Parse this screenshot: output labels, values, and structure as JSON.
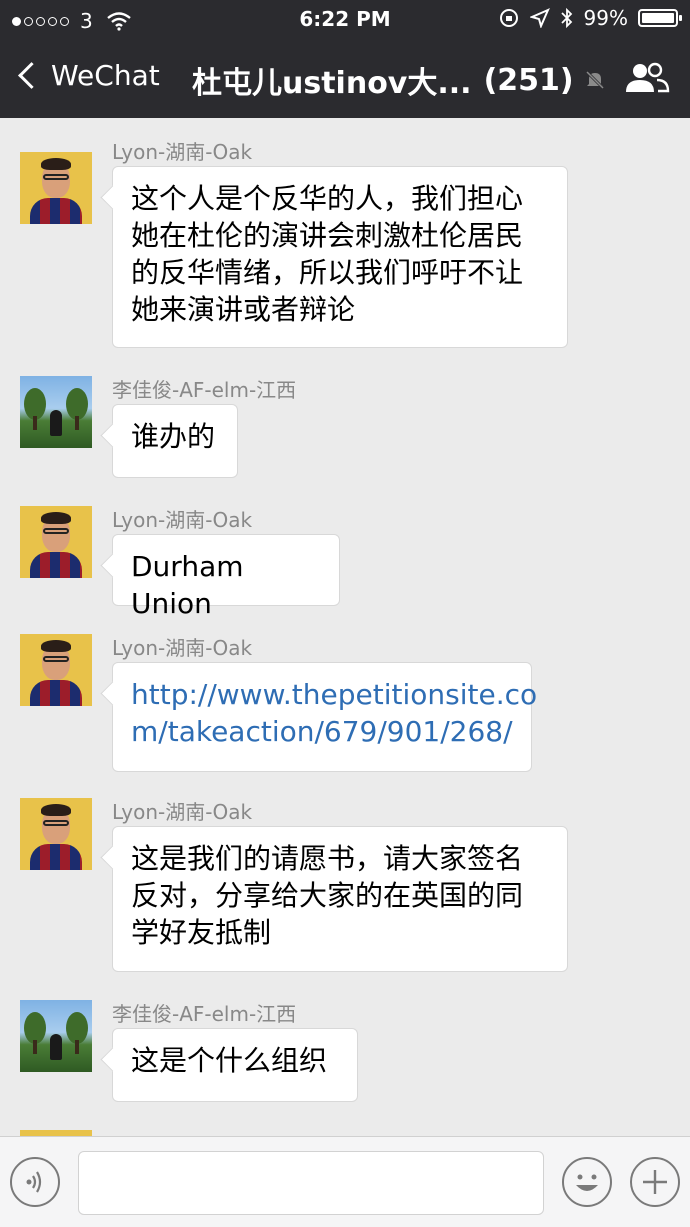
{
  "status_bar": {
    "carrier": "3",
    "time": "6:22 PM",
    "battery": "99%",
    "battery_level": 0.99,
    "signal_bars": 1
  },
  "nav": {
    "back_label": "WeChat",
    "title": "杜屯儿ustinov大...",
    "member_count": "(251)"
  },
  "messages": [
    {
      "sender": "Lyon-湖南-Oak",
      "text": "这个人是个反华的人，我们担心\n她在杜伦的演讲会刺激杜伦居民\n的反华情绪，所以我们呼吁不让\n她来演讲或者辩论",
      "avatar": "lyon-avatar"
    },
    {
      "sender": "李佳俊-AF-elm-江西",
      "text": "谁办的",
      "avatar": "li-avatar"
    },
    {
      "sender": "Lyon-湖南-Oak",
      "text": "Durham Union",
      "avatar": "lyon-avatar"
    },
    {
      "sender": "Lyon-湖南-Oak",
      "text": "http://www.thepetitionsite.co\nm/takeaction/679/901/268/",
      "avatar": "lyon-avatar",
      "is_link": true
    },
    {
      "sender": "Lyon-湖南-Oak",
      "text": "这是我们的请愿书，请大家签名\n反对，分享给大家的在英国的同\n学好友抵制",
      "avatar": "lyon-avatar"
    },
    {
      "sender": "李佳俊-AF-elm-江西",
      "text": "这是个什么组织",
      "avatar": "li-avatar"
    }
  ],
  "colors": {
    "header_bg": "#2b2b2f",
    "chat_bg": "#ebebeb",
    "link": "#2e6db4"
  },
  "icons": {
    "back": "chevron-left-icon",
    "mute": "mute-bell-icon",
    "members": "group-members-icon",
    "voice": "voice-input-icon",
    "emoji": "emoji-icon",
    "plus": "plus-icon"
  }
}
